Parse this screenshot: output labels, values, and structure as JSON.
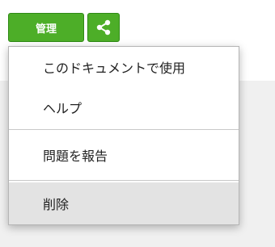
{
  "toolbar": {
    "manage_label": "管理",
    "share_icon": "share-icon"
  },
  "colors": {
    "button_green": "#4dae28",
    "highlight": "#e3e3e3"
  },
  "menu": {
    "items": [
      {
        "label": "このドキュメントで使用"
      },
      {
        "label": "ヘルプ"
      },
      {
        "label": "問題を報告"
      },
      {
        "label": "削除",
        "highlighted": true
      }
    ]
  }
}
